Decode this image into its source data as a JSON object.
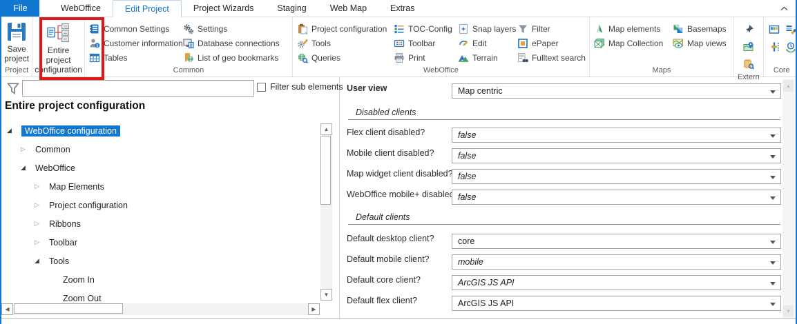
{
  "tabs": {
    "file": "File",
    "items": [
      "WebOffice",
      "Edit Project",
      "Project Wizards",
      "Staging",
      "Web Map",
      "Extras"
    ],
    "active": "Edit Project"
  },
  "ribbon": {
    "project": {
      "label": "Project",
      "save": "Save project"
    },
    "entire_project": "Entire project configuration",
    "common": {
      "label": "Common",
      "buttons": [
        "Common Settings",
        "Settings",
        "Customer information",
        "Database connections",
        "Tables",
        "List of geo bookmarks"
      ]
    },
    "weboffice": {
      "label": "WebOffice",
      "buttons": [
        "Project configuration",
        "TOC-Config",
        "Snap layers",
        "Filter",
        "Tools",
        "Toolbar",
        "Edit",
        "ePaper",
        "Queries",
        "Print",
        "Terrain",
        "Fulltext search"
      ]
    },
    "maps": {
      "label": "Maps",
      "buttons": [
        "Map elements",
        "Basemaps",
        "Map Collection",
        "Map views"
      ]
    },
    "extern": {
      "label": "Extern",
      "icons": [
        "pushpin-icon",
        "map-marker-icon",
        "database-search-icon"
      ]
    },
    "core": {
      "label": "Core",
      "icons": [
        "panel-icon",
        "wrench-icon",
        "slider-icon",
        "clock-icon"
      ]
    }
  },
  "left_panel": {
    "filter_value": "",
    "filter_checkbox_label": "Filter sub elements",
    "heading": "Entire project configuration",
    "tree": [
      {
        "label": "WebOffice configuration",
        "level": 0,
        "state": "expanded",
        "selected": true
      },
      {
        "label": "Common",
        "level": 1,
        "state": "collapsed"
      },
      {
        "label": "WebOffice",
        "level": 1,
        "state": "expanded"
      },
      {
        "label": "Map Elements",
        "level": 2,
        "state": "collapsed"
      },
      {
        "label": "Project configuration",
        "level": 2,
        "state": "collapsed"
      },
      {
        "label": "Ribbons",
        "level": 2,
        "state": "collapsed"
      },
      {
        "label": "Toolbar",
        "level": 2,
        "state": "collapsed"
      },
      {
        "label": "Tools",
        "level": 2,
        "state": "expanded"
      },
      {
        "label": "Zoom In",
        "level": 3,
        "state": "leaf"
      },
      {
        "label": "Zoom Out",
        "level": 3,
        "state": "leaf"
      }
    ]
  },
  "form": {
    "user_view": {
      "label": "User view",
      "value": "Map centric"
    },
    "sections": [
      "Disabled clients",
      "Default clients"
    ],
    "disabled_rows": [
      {
        "label": "Flex client disabled?",
        "value": "false"
      },
      {
        "label": "Mobile client disabled?",
        "value": "false"
      },
      {
        "label": "Map widget client disabled?",
        "value": "false"
      },
      {
        "label": "WebOffice mobile+ disabled?",
        "value": "false"
      }
    ],
    "default_rows": [
      {
        "label": "Default desktop client?",
        "value": "core"
      },
      {
        "label": "Default mobile client?",
        "value": "mobile"
      },
      {
        "label": "Default core client?",
        "value": "ArcGIS JS API"
      },
      {
        "label": "Default flex client?",
        "value": "ArcGIS JS API"
      }
    ]
  },
  "colors": {
    "accent_blue": "#1177d1",
    "highlight_red": "#e01717",
    "icon_green": "#3f9e63",
    "icon_orange": "#e3a23c"
  }
}
